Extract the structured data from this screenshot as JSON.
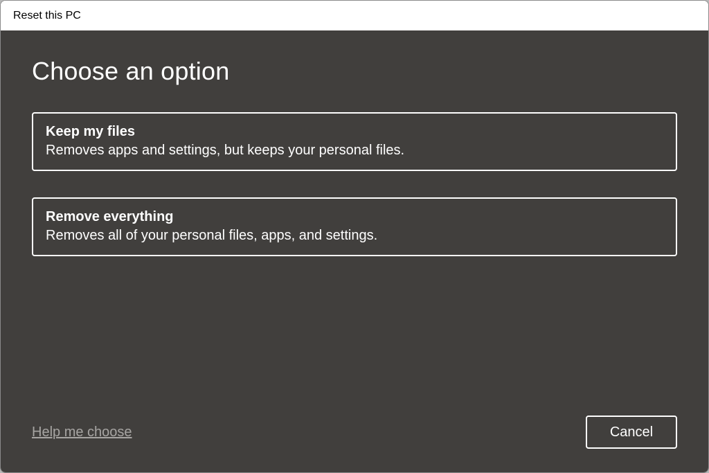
{
  "window": {
    "title": "Reset this PC"
  },
  "heading": "Choose an option",
  "options": [
    {
      "title": "Keep my files",
      "description": "Removes apps and settings, but keeps your personal files."
    },
    {
      "title": "Remove everything",
      "description": "Removes all of your personal files, apps, and settings."
    }
  ],
  "footer": {
    "help_link": "Help me choose",
    "cancel_label": "Cancel"
  }
}
